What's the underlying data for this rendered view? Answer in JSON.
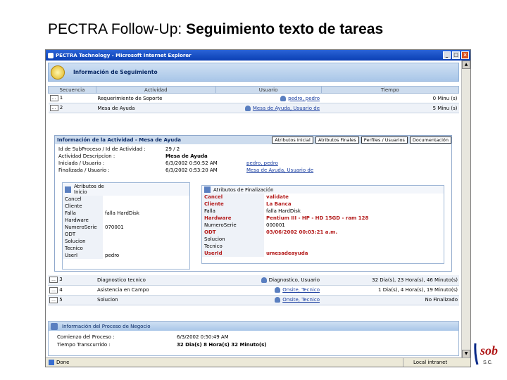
{
  "slide": {
    "title_prefix": "PECTRA Follow-Up:",
    "title_bold": "Seguimiento texto de tareas"
  },
  "window": {
    "title": "PECTRA Technology - Microsoft Internet Explorer",
    "minimize": "_",
    "maximize": "□",
    "close": "×"
  },
  "header": {
    "title": "Información de Seguimiento"
  },
  "table": {
    "columns": [
      "Secuencia",
      "Actividad",
      "Usuario",
      "Tiempo"
    ],
    "rows_top": [
      {
        "btn": "...",
        "seq": "1",
        "activity": "Requerimiento de Soporte",
        "user": "pedro, pedro",
        "time": "0 Minu (s)"
      },
      {
        "btn": "...",
        "seq": "2",
        "activity": "Mesa de Ayuda",
        "user": "Mesa de Ayuda, Usuario de",
        "time": "5 Minu (s)"
      }
    ],
    "rows_bottom": [
      {
        "btn": "...",
        "seq": "3",
        "activity": "Diagnostico tecnico",
        "user": "Diagnostico, Usuario",
        "time": "32 Dia(s), 23 Hora(s), 46 Minuto(s)"
      },
      {
        "btn": "...",
        "seq": "4",
        "activity": "Asistencia en Campo",
        "user": "Onsite, Tecnico",
        "time": "1 Dia(s), 4 Hora(s), 19 Minuto(s)"
      },
      {
        "btn": "...",
        "seq": "5",
        "activity": "Solucion",
        "user": "Onsite, Tecnico",
        "time": "No Finalizado"
      }
    ]
  },
  "detail": {
    "title": "Información de la Actividad - Mesa de Ayuda",
    "tabs": [
      "Atributos Inicial",
      "Atributos Finales",
      "Perfiles / Usuarios",
      "Documentación"
    ],
    "fields": [
      {
        "key": "Id de SubProceso / Id de Actividad :",
        "value": "29 / 2",
        "bold": false
      },
      {
        "key": "Actividad Descripcion :",
        "value": "Mesa de Ayuda",
        "bold": true
      },
      {
        "key": "Iniciada / Usuario :",
        "value": "6/3/2002 0:50:52 AM",
        "value2": "pedro, pedro"
      },
      {
        "key": "Finalizada / Usuario :",
        "value": "6/3/2002 0:53:20 AM",
        "value2": "Mesa de Ayuda, Usuario de"
      }
    ]
  },
  "attr_init": {
    "title_line1": "Atributos de",
    "title_line2": "Inicio",
    "rows": [
      {
        "label": "Cancel",
        "value": ""
      },
      {
        "label": "Cliente",
        "value": ""
      },
      {
        "label": "Falla",
        "value": "falla HardDisk"
      },
      {
        "label": "Hardware",
        "value": ""
      },
      {
        "label": "NumeroSerie",
        "value": "070001"
      },
      {
        "label": "ODT",
        "value": ""
      },
      {
        "label": "Solucion",
        "value": ""
      },
      {
        "label": "Tecnico",
        "value": ""
      },
      {
        "label": "UserI",
        "value": "pedro"
      }
    ]
  },
  "attr_fin": {
    "title": "Atributos de Finalización",
    "rows": [
      {
        "label": "Cancel",
        "value": "validate",
        "red": true
      },
      {
        "label": "Cliente",
        "value": "La Banca",
        "red": true
      },
      {
        "label": "Falla",
        "value": "falla HardDisk",
        "red": false
      },
      {
        "label": "Hardware",
        "value": "Pentium III - HP - HD 15GD - ram 128",
        "red": true
      },
      {
        "label": "NumeroSerie",
        "value": "000001",
        "red": false
      },
      {
        "label": "ODT",
        "value": "03/06/2002 00:03:21 a.m.",
        "red": true
      },
      {
        "label": "Solucion",
        "value": "",
        "red": false
      },
      {
        "label": "Tecnico",
        "value": "",
        "red": false
      },
      {
        "label": "UserId",
        "value": "umesadeayuda",
        "red": true
      }
    ]
  },
  "process": {
    "title": "Información del Proceso de Negocio",
    "rows": [
      {
        "key": "Comienzo del Proceso :",
        "value": "6/3/2002 0:50:49 AM"
      },
      {
        "key": "Tiempo Transcurrido :",
        "value": "32 Dia(s) 8 Hora(s) 32 Minuto(s)"
      }
    ]
  },
  "status": {
    "left": "Done",
    "zone": "Local intranet"
  },
  "logo": {
    "text": "sob",
    "sub": "S.C."
  }
}
